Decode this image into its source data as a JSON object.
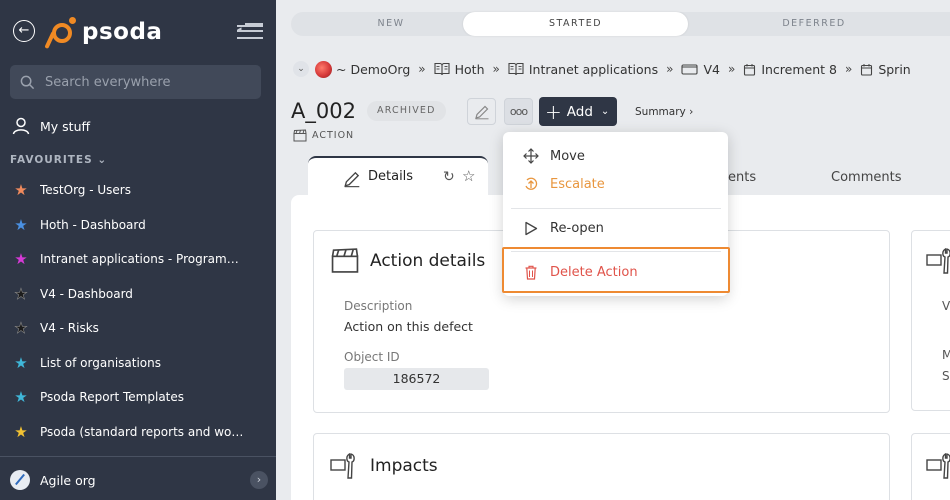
{
  "sidebar": {
    "logo_text": "psoda",
    "search_placeholder": "Search everywhere",
    "my_stuff": "My stuff",
    "favourites_header": "FAVOURITES",
    "favourites": [
      {
        "label": "TestOrg - Users",
        "star_color": "#f08a5d"
      },
      {
        "label": "Hoth - Dashboard",
        "star_color": "#4a90e2"
      },
      {
        "label": "Intranet applications - Programme...",
        "star_color": "#d63ad6"
      },
      {
        "label": "V4 - Dashboard",
        "star_color": "#1c1c1c"
      },
      {
        "label": "V4 - Risks",
        "star_color": "#1c1c1c"
      },
      {
        "label": "List of organisations",
        "star_color": "#3fb7d9"
      },
      {
        "label": "Psoda Report Templates",
        "star_color": "#3fb7d9"
      },
      {
        "label": "Psoda (standard reports and work...",
        "star_color": "#f2c233"
      }
    ],
    "org_name": "Agile org"
  },
  "status_bar": {
    "segments": [
      {
        "label": "NEW",
        "active": false
      },
      {
        "label": "STARTED",
        "active": true
      },
      {
        "label": "DEFERRED",
        "active": false
      }
    ]
  },
  "breadcrumb": [
    {
      "label": "~ DemoOrg",
      "icon": "org-logo-icon"
    },
    {
      "label": "Hoth",
      "icon": "book-icon"
    },
    {
      "label": "Intranet applications",
      "icon": "book-icon"
    },
    {
      "label": "V4",
      "icon": "folder-icon"
    },
    {
      "label": "Increment 8",
      "icon": "calendar-icon"
    },
    {
      "label": "Sprin",
      "icon": "calendar-icon"
    }
  ],
  "header": {
    "title": "A_002",
    "badge": "ARCHIVED",
    "type_label": "ACTION",
    "add_label": "Add",
    "summary_label": "Summary ›"
  },
  "tabs": {
    "details": "Details",
    "ents": "ents",
    "comments": "Comments"
  },
  "action_details": {
    "title": "Action details",
    "description_label": "Description",
    "description_value": "Action on this defect",
    "object_id_label": "Object ID",
    "object_id_value": "186572"
  },
  "impacts": {
    "title": "Impacts"
  },
  "right_card_partial": {
    "line1": "V",
    "line2": "M",
    "line3": "S"
  },
  "dropdown": {
    "move": "Move",
    "escalate": "Escalate",
    "reopen": "Re-open",
    "delete": "Delete Action"
  },
  "colors": {
    "sidebar_bg": "#2f3645",
    "accent_orange": "#ee8a32",
    "delete_red": "#e0534a",
    "escalate_orange": "#e8963e"
  }
}
